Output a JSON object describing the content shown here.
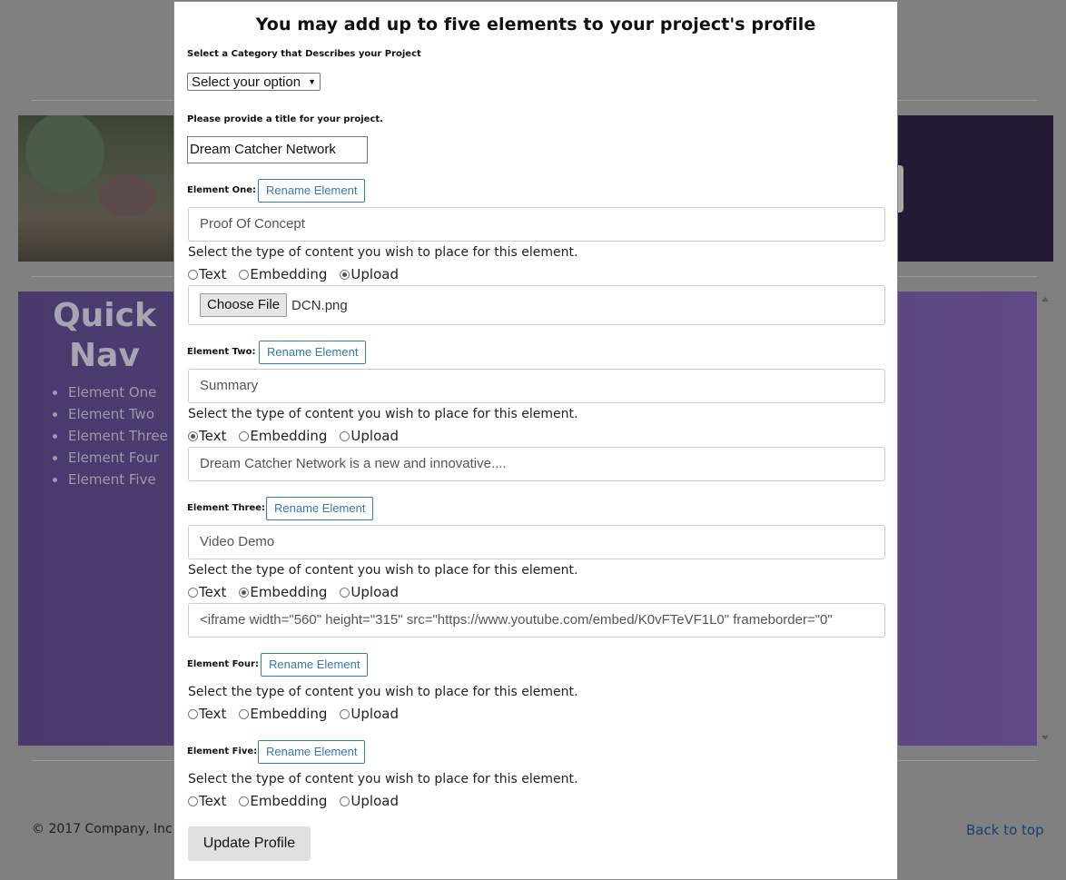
{
  "background": {
    "quicknav": {
      "title_line1": "Quick",
      "title_line2": "Nav",
      "items": [
        "Element One",
        "Element Two",
        "Element Three",
        "Element Four",
        "Element Five"
      ]
    },
    "footer": {
      "copyright": "© 2017 Company, Inc.",
      "back_to_top": "Back to top"
    }
  },
  "modal": {
    "title": "You may add up to five elements to your project's profile",
    "category": {
      "label": "Select a Category that Describes your Project",
      "selected": "Select your option"
    },
    "project_title": {
      "label": "Please provide a title for your project.",
      "value": "Dream Catcher Network"
    },
    "rename_label": "Rename Element",
    "content_prompt": "Select the type of content you wish to place for this element.",
    "options": [
      "Text",
      "Embedding",
      "Upload"
    ],
    "elements": [
      {
        "label": "Element One:",
        "name": "Proof Of Concept",
        "selected": "Upload",
        "file_button": "Choose File",
        "file_name": "DCN.png"
      },
      {
        "label": "Element Two:",
        "name": "Summary",
        "selected": "Text",
        "content": "Dream Catcher Network is a new and innovative...."
      },
      {
        "label": "Element Three:",
        "name": "Video Demo",
        "selected": "Embedding",
        "content": "<iframe width=\"560\" height=\"315\" src=\"https://www.youtube.com/embed/K0vFTeVF1L0\" frameborder=\"0\""
      },
      {
        "label": "Element Four:",
        "selected": ""
      },
      {
        "label": "Element Five:",
        "selected": ""
      }
    ],
    "update_button": "Update Profile"
  }
}
